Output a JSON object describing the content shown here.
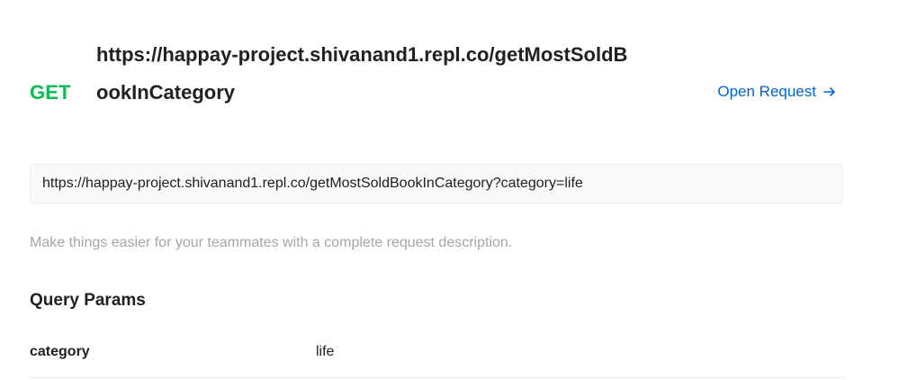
{
  "request": {
    "method": "GET",
    "title": "https://happay-project.shivanand1.repl.co/getMostSoldBookInCategory",
    "open_request_label": "Open Request",
    "open_request_icon": "arrow-right-icon",
    "method_color": "#0cbb52",
    "link_color": "#0265d2"
  },
  "url": {
    "value": "https://happay-project.shivanand1.repl.co/getMostSoldBookInCategory?category=life"
  },
  "description": {
    "placeholder": "Make things easier for your teammates with a complete request description."
  },
  "query_params": {
    "title": "Query Params",
    "rows": [
      {
        "key": "category",
        "value": "life"
      }
    ]
  }
}
